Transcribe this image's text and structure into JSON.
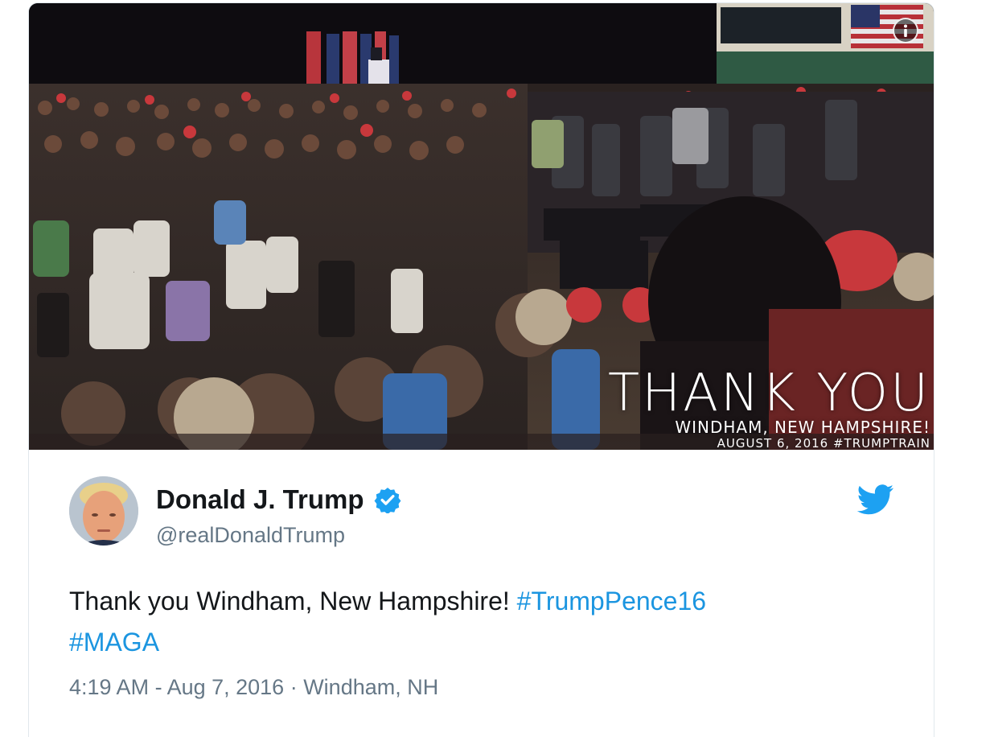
{
  "media": {
    "overlay_line1": "THANK YOU",
    "overlay_line2": "WINDHAM, NEW HAMPSHIRE!",
    "overlay_line3": "AUGUST 6, 2016 #TRUMPTRAIN",
    "info_icon": "info-icon"
  },
  "author": {
    "name": "Donald J. Trump",
    "handle": "@realDonaldTrump",
    "verified_icon": "verified-badge-icon",
    "verified_color": "#1da1f2"
  },
  "tweet": {
    "text_main": "Thank you Windham, New Hampshire! ",
    "hashtag1": "#TrumpPence16",
    "hashtag2": "#MAGA",
    "hashtag_color": "#1b95e0"
  },
  "meta": {
    "time": "4:19 AM - Aug 7, 2016",
    "separator": " · ",
    "location": "Windham, NH",
    "brand_icon": "twitter-bird-icon",
    "brand_color": "#1da1f2"
  }
}
